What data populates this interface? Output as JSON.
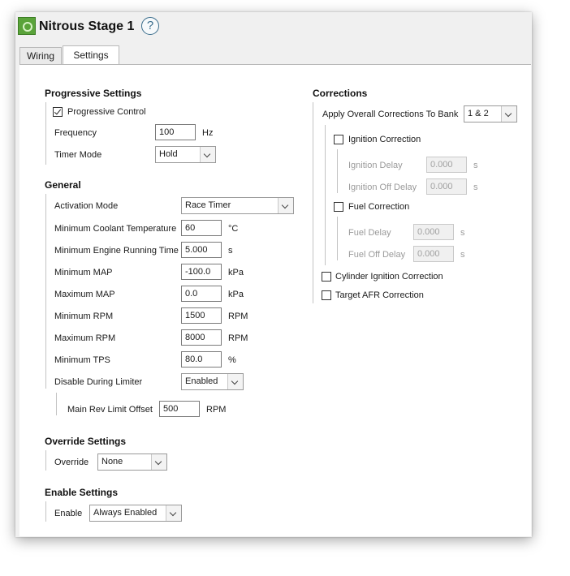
{
  "window": {
    "title": "Nitrous Stage 1",
    "help_glyph": "?"
  },
  "tabs": [
    {
      "label": "Wiring"
    },
    {
      "label": "Settings"
    }
  ],
  "progressive": {
    "header": "Progressive Settings",
    "control_label": "Progressive Control",
    "control_checked": true,
    "frequency": {
      "label": "Frequency",
      "value": "100",
      "unit": "Hz"
    },
    "timer_mode": {
      "label": "Timer Mode",
      "value": "Hold"
    }
  },
  "general": {
    "header": "General",
    "activation_mode": {
      "label": "Activation Mode",
      "value": "Race Timer"
    },
    "min_coolant": {
      "label": "Minimum Coolant Temperature",
      "value": "60",
      "unit": "°C"
    },
    "min_engine_time": {
      "label": "Minimum Engine Running Time",
      "value": "5.000",
      "unit": "s"
    },
    "min_map": {
      "label": "Minimum MAP",
      "value": "-100.0",
      "unit": "kPa"
    },
    "max_map": {
      "label": "Maximum MAP",
      "value": "0.0",
      "unit": "kPa"
    },
    "min_rpm": {
      "label": "Minimum RPM",
      "value": "1500",
      "unit": "RPM"
    },
    "max_rpm": {
      "label": "Maximum RPM",
      "value": "8000",
      "unit": "RPM"
    },
    "min_tps": {
      "label": "Minimum TPS",
      "value": "80.0",
      "unit": "%"
    },
    "disable_limiter": {
      "label": "Disable During Limiter",
      "value": "Enabled"
    },
    "rev_limit_offset": {
      "label": "Main Rev Limit Offset",
      "value": "500",
      "unit": "RPM"
    }
  },
  "override": {
    "header": "Override Settings",
    "label": "Override",
    "value": "None"
  },
  "enable": {
    "header": "Enable Settings",
    "label": "Enable",
    "value": "Always Enabled"
  },
  "corrections": {
    "header": "Corrections",
    "apply_bank": {
      "label": "Apply Overall Corrections To Bank",
      "value": "1 & 2"
    },
    "ignition": {
      "label": "Ignition Correction",
      "checked": false,
      "delay": {
        "label": "Ignition Delay",
        "value": "0.000",
        "unit": "s"
      },
      "off_delay": {
        "label": "Ignition Off Delay",
        "value": "0.000",
        "unit": "s"
      }
    },
    "fuel": {
      "label": "Fuel Correction",
      "checked": false,
      "delay": {
        "label": "Fuel Delay",
        "value": "0.000",
        "unit": "s"
      },
      "off_delay": {
        "label": "Fuel Off Delay",
        "value": "0.000",
        "unit": "s"
      }
    },
    "cylinder_ignition": {
      "label": "Cylinder Ignition Correction",
      "checked": false
    },
    "target_afr": {
      "label": "Target AFR Correction",
      "checked": false
    }
  }
}
